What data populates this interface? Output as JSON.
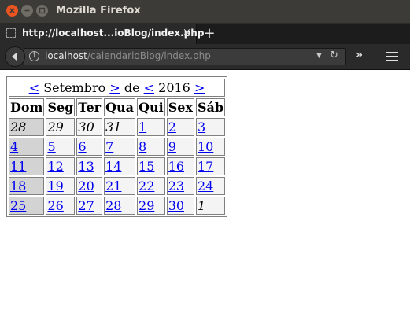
{
  "window": {
    "title": "Mozilla Firefox"
  },
  "tab": {
    "title": "http://localhost...ioBlog/index.php",
    "close": "×",
    "new_tab": "+"
  },
  "urlbar": {
    "host": "localhost",
    "path": "/calendarioBlog/index.php",
    "info_icon": "i"
  },
  "toolbar": {
    "overflow": "»"
  },
  "calendar": {
    "prev_month": "<",
    "month": "Setembro",
    "next_month": ">",
    "separator": "de",
    "prev_year": "<",
    "year": "2016",
    "next_year": ">",
    "weekdays": [
      "Dom",
      "Seg",
      "Ter",
      "Qua",
      "Qui",
      "Sex",
      "Sáb"
    ],
    "weeks": [
      [
        {
          "d": "28",
          "link": false,
          "other": true
        },
        {
          "d": "29",
          "link": false,
          "other": true
        },
        {
          "d": "30",
          "link": false,
          "other": true
        },
        {
          "d": "31",
          "link": false,
          "other": true
        },
        {
          "d": "1",
          "link": true,
          "other": false
        },
        {
          "d": "2",
          "link": true,
          "other": false
        },
        {
          "d": "3",
          "link": true,
          "other": false
        }
      ],
      [
        {
          "d": "4",
          "link": true,
          "other": false
        },
        {
          "d": "5",
          "link": true,
          "other": false
        },
        {
          "d": "6",
          "link": true,
          "other": false
        },
        {
          "d": "7",
          "link": true,
          "other": false
        },
        {
          "d": "8",
          "link": true,
          "other": false
        },
        {
          "d": "9",
          "link": true,
          "other": false
        },
        {
          "d": "10",
          "link": true,
          "other": false
        }
      ],
      [
        {
          "d": "11",
          "link": true,
          "other": false
        },
        {
          "d": "12",
          "link": true,
          "other": false
        },
        {
          "d": "13",
          "link": true,
          "other": false
        },
        {
          "d": "14",
          "link": true,
          "other": false
        },
        {
          "d": "15",
          "link": true,
          "other": false
        },
        {
          "d": "16",
          "link": true,
          "other": false
        },
        {
          "d": "17",
          "link": true,
          "other": false
        }
      ],
      [
        {
          "d": "18",
          "link": true,
          "other": false
        },
        {
          "d": "19",
          "link": true,
          "other": false
        },
        {
          "d": "20",
          "link": true,
          "other": false
        },
        {
          "d": "21",
          "link": true,
          "other": false
        },
        {
          "d": "22",
          "link": true,
          "other": false
        },
        {
          "d": "23",
          "link": true,
          "other": false
        },
        {
          "d": "24",
          "link": true,
          "other": false
        }
      ],
      [
        {
          "d": "25",
          "link": true,
          "other": false
        },
        {
          "d": "26",
          "link": true,
          "other": false
        },
        {
          "d": "27",
          "link": true,
          "other": false
        },
        {
          "d": "28",
          "link": true,
          "other": false
        },
        {
          "d": "29",
          "link": true,
          "other": false
        },
        {
          "d": "30",
          "link": true,
          "other": false
        },
        {
          "d": "1",
          "link": false,
          "other": true
        }
      ]
    ]
  },
  "colors": {
    "link": "#0000ee",
    "sunday_cell": "#d3d3d3",
    "close_button": "#e95420"
  }
}
